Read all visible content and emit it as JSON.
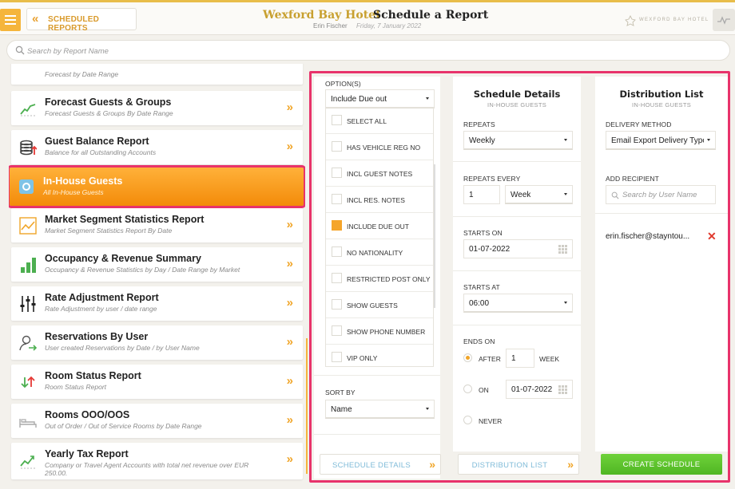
{
  "header": {
    "back_label": "SCHEDULED REPORTS",
    "hotel_name": "Wexford Bay Hotel",
    "page_title": "Schedule a Report",
    "user": "Erin Fischer",
    "date": "Friday, 7 January 2022",
    "brand_text": "WEXFORD BAY HOTEL",
    "accent_color": "#f5b53c"
  },
  "search": {
    "placeholder": "Search by Report Name"
  },
  "reports": [
    {
      "name": "",
      "desc": "Forecast by Date Range",
      "icon": "partial-icon"
    },
    {
      "name": "Forecast Guests & Groups",
      "desc": "Forecast Guests & Groups By Date Range",
      "icon": "trend-chart-icon"
    },
    {
      "name": "Guest Balance Report",
      "desc": "Balance for all Outstanding Accounts",
      "icon": "coins-icon"
    },
    {
      "name": "In-House Guests",
      "desc": "All In-House Guests",
      "icon": "guest-circle-icon",
      "active": true
    },
    {
      "name": "Market Segment Statistics Report",
      "desc": "Market Segment Statistics Report By Date",
      "icon": "line-graph-icon"
    },
    {
      "name": "Occupancy & Revenue Summary",
      "desc": "Occupancy & Revenue Statistics by Day / Date Range by Market",
      "icon": "bar-chart-icon"
    },
    {
      "name": "Rate Adjustment Report",
      "desc": "Rate Adjustment by user / date range",
      "icon": "sliders-icon"
    },
    {
      "name": "Reservations By User",
      "desc": "User created Reservations by Date / by User Name",
      "icon": "user-arrow-icon"
    },
    {
      "name": "Room Status Report",
      "desc": "Room Status Report",
      "icon": "up-down-arrows-icon"
    },
    {
      "name": "Rooms OOO/OOS",
      "desc": "Out of Order / Out of Service Rooms by Date Range",
      "icon": "bed-icon"
    },
    {
      "name": "Yearly Tax Report",
      "desc": "Company or Travel Agent Accounts with total net revenue over EUR 250.00.",
      "icon": "chart-up-icon"
    }
  ],
  "options": {
    "label": "OPTION(S)",
    "selected": "Include Due out",
    "items": [
      {
        "label": "SELECT ALL",
        "checked": false
      },
      {
        "label": "HAS VEHICLE REG NO",
        "checked": false
      },
      {
        "label": "INCL GUEST NOTES",
        "checked": false
      },
      {
        "label": "INCL RES. NOTES",
        "checked": false
      },
      {
        "label": "INCLUDE DUE OUT",
        "checked": true
      },
      {
        "label": "NO NATIONALITY",
        "checked": false
      },
      {
        "label": "RESTRICTED POST ONLY",
        "checked": false
      },
      {
        "label": "SHOW GUESTS",
        "checked": false
      },
      {
        "label": "SHOW PHONE NUMBER",
        "checked": false
      },
      {
        "label": "VIP ONLY",
        "checked": false
      }
    ],
    "sort_label": "SORT BY",
    "sort_value": "Name",
    "next_button": "SCHEDULE DETAILS"
  },
  "schedule": {
    "title": "Schedule Details",
    "subtitle": "IN-HOUSE GUESTS",
    "repeats_label": "REPEATS",
    "repeats_value": "Weekly",
    "repeats_every_label": "REPEATS EVERY",
    "repeats_every_num": "1",
    "repeats_every_unit": "Week",
    "starts_on_label": "STARTS ON",
    "starts_on_value": "01-07-2022",
    "starts_at_label": "STARTS AT",
    "starts_at_value": "06:00",
    "ends_on_label": "ENDS ON",
    "after_label": "AFTER",
    "after_value": "1",
    "after_unit": "WEEK",
    "on_label": "ON",
    "on_value": "01-07-2022",
    "never_label": "NEVER",
    "ends_selected": "AFTER",
    "next_button": "DISTRIBUTION LIST"
  },
  "distribution": {
    "title": "Distribution List",
    "subtitle": "IN-HOUSE GUESTS",
    "method_label": "DELIVERY METHOD",
    "method_value": "Email Export Delivery Type",
    "recipient_label": "ADD RECIPIENT",
    "recipient_placeholder": "Search by User Name",
    "recipients": [
      "erin.fischer@stayntou..."
    ],
    "create_button": "CREATE SCHEDULE"
  }
}
